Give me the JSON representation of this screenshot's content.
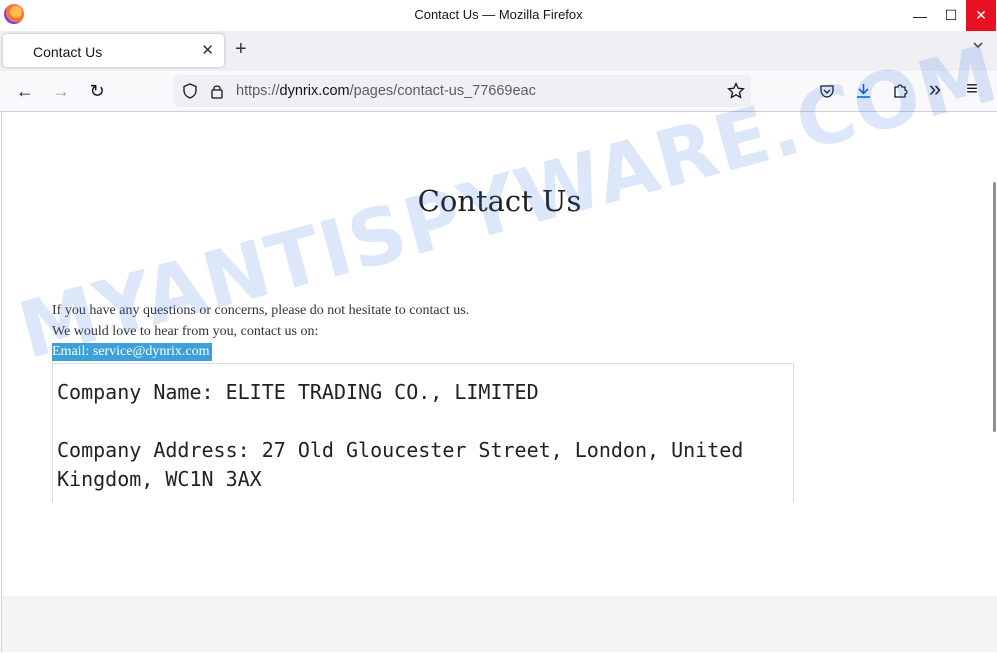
{
  "window": {
    "title": "Contact Us — Mozilla Firefox",
    "minimize": "—",
    "maximize": "☐",
    "close": "✕"
  },
  "tabs": [
    {
      "label": "Contact Us",
      "close": "✕"
    }
  ],
  "tabstrip": {
    "new_tab": "+"
  },
  "toolbar": {
    "back": "←",
    "forward": "→",
    "reload": "↻",
    "more_tools": "»",
    "menu": "≡"
  },
  "urlbar": {
    "prefix": "https://",
    "domain": "dynrix.com",
    "path": "/pages/contact-us_77669eac"
  },
  "page": {
    "title": "Contact Us",
    "intro_line1": "If you have any questions or concerns, please do not hesitate to contact us.",
    "intro_line2": "We would love to hear from you, contact us on:",
    "email": "Email: service@dynrix.com",
    "company_name": "Company Name: ELITE TRADING CO., LIMITED",
    "company_address_line1": "Company Address: 27 Old Gloucester Street, London, United",
    "company_address_line2": "Kingdom, WC1N 3AX"
  },
  "watermark": "MYANTISPYWARE.COM",
  "colors": {
    "close_button": "#e81123",
    "selection_highlight": "#3ea0d8",
    "download_icon": "#0061e0"
  }
}
